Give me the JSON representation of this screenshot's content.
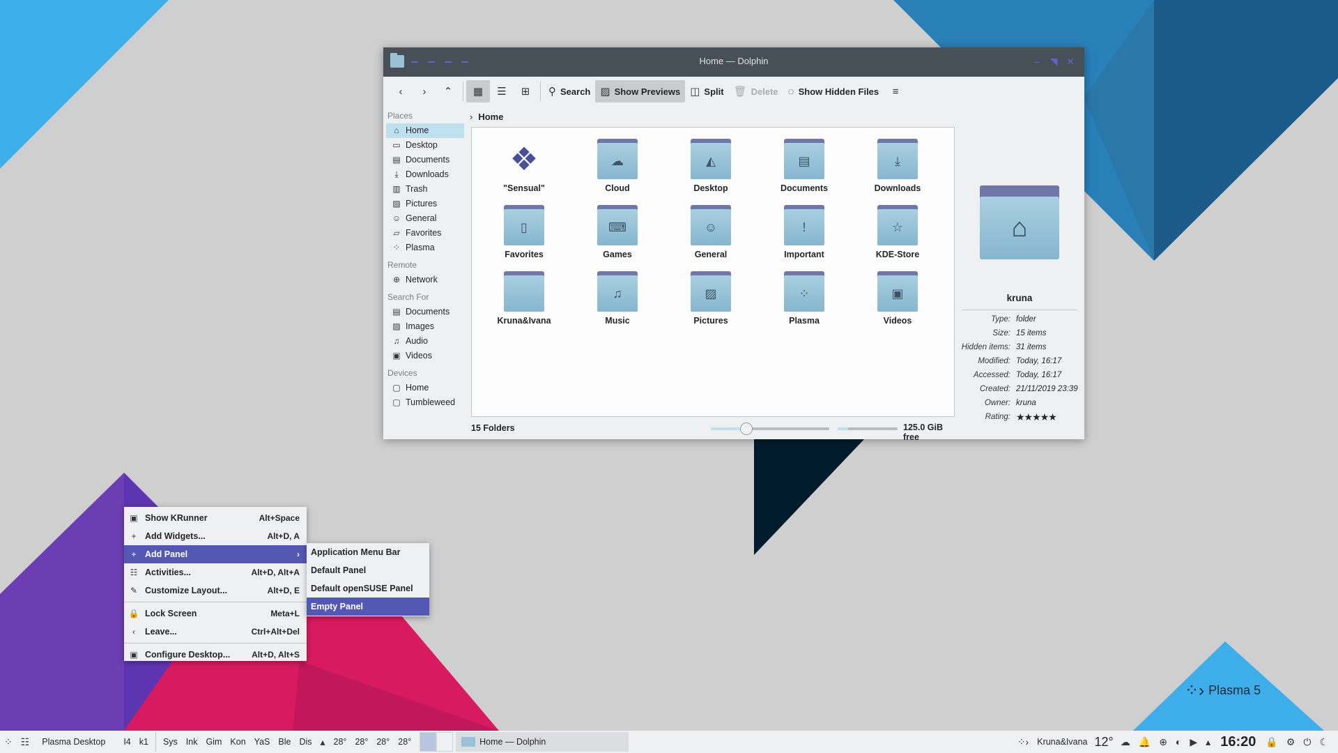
{
  "window": {
    "title": "Home — Dolphin"
  },
  "toolbar": {
    "back_icon": "back-icon",
    "forward_icon": "forward-icon",
    "up_icon": "up-icon",
    "search_label": "Search",
    "show_previews_label": "Show Previews",
    "split_label": "Split",
    "delete_label": "Delete",
    "show_hidden_label": "Show Hidden Files"
  },
  "places": {
    "places_header": "Places",
    "places_items": [
      {
        "label": "Home",
        "icon": "home-icon"
      },
      {
        "label": "Desktop",
        "icon": "desktop-icon"
      },
      {
        "label": "Documents",
        "icon": "documents-icon"
      },
      {
        "label": "Downloads",
        "icon": "downloads-icon"
      },
      {
        "label": "Trash",
        "icon": "trash-icon"
      },
      {
        "label": "Pictures",
        "icon": "pictures-icon"
      },
      {
        "label": "General",
        "icon": "general-icon"
      },
      {
        "label": "Favorites",
        "icon": "favorites-icon"
      },
      {
        "label": "Plasma",
        "icon": "plasma-icon"
      }
    ],
    "remote_header": "Remote",
    "remote_items": [
      {
        "label": "Network",
        "icon": "network-icon"
      }
    ],
    "search_header": "Search For",
    "search_items": [
      {
        "label": "Documents",
        "icon": "documents-icon"
      },
      {
        "label": "Images",
        "icon": "images-icon"
      },
      {
        "label": "Audio",
        "icon": "audio-icon"
      },
      {
        "label": "Videos",
        "icon": "videos-icon"
      }
    ],
    "devices_header": "Devices",
    "devices_items": [
      {
        "label": "Home",
        "icon": "drive-icon"
      },
      {
        "label": "Tumbleweed",
        "icon": "drive-icon"
      }
    ]
  },
  "breadcrumb": {
    "current": "Home"
  },
  "files": [
    {
      "name": "\"Sensual\"",
      "icon": "sensual-logo-icon"
    },
    {
      "name": "Cloud",
      "icon": "cloud-icon"
    },
    {
      "name": "Desktop",
      "icon": "desktop-folder-icon"
    },
    {
      "name": "Documents",
      "icon": "documents-folder-icon"
    },
    {
      "name": "Downloads",
      "icon": "downloads-folder-icon"
    },
    {
      "name": "Favorites",
      "icon": "favorites-folder-icon"
    },
    {
      "name": "Games",
      "icon": "games-folder-icon"
    },
    {
      "name": "General",
      "icon": "general-folder-icon"
    },
    {
      "name": "Important",
      "icon": "important-folder-icon"
    },
    {
      "name": "KDE-Store",
      "icon": "kde-store-folder-icon"
    },
    {
      "name": "Kruna&Ivana",
      "icon": "folder-icon"
    },
    {
      "name": "Music",
      "icon": "music-folder-icon"
    },
    {
      "name": "Pictures",
      "icon": "pictures-folder-icon"
    },
    {
      "name": "Plasma",
      "icon": "plasma-folder-icon"
    },
    {
      "name": "Videos",
      "icon": "videos-folder-icon"
    }
  ],
  "status": {
    "count": "15 Folders",
    "zoom_fraction": 0.3,
    "capacity_fraction": 0.18,
    "free": "125.0 GiB free"
  },
  "info_panel": {
    "name": "kruna",
    "props": [
      {
        "k": "Type:",
        "v": "folder"
      },
      {
        "k": "Size:",
        "v": "15 items"
      },
      {
        "k": "Hidden items:",
        "v": "31 items"
      },
      {
        "k": "Modified:",
        "v": "Today, 16:17"
      },
      {
        "k": "Accessed:",
        "v": "Today, 16:17"
      },
      {
        "k": "Created:",
        "v": "21/11/2019 23:39"
      },
      {
        "k": "Owner:",
        "v": "kruna"
      }
    ],
    "rating_label": "Rating:",
    "rating_stars": 5
  },
  "context_menu": {
    "items": [
      {
        "label": "Show KRunner",
        "shortcut": "Alt+Space",
        "icon": "krunner-icon"
      },
      {
        "label": "Add Widgets...",
        "shortcut": "Alt+D, A",
        "icon": "plus-icon"
      },
      {
        "label": "Add Panel",
        "shortcut": "",
        "icon": "plus-icon",
        "submenu": true
      },
      {
        "label": "Activities...",
        "shortcut": "Alt+D, Alt+A",
        "icon": "activities-icon"
      },
      {
        "label": "Customize Layout...",
        "shortcut": "Alt+D, E",
        "icon": "edit-icon"
      },
      {
        "sep": true
      },
      {
        "label": "Lock Screen",
        "shortcut": "Meta+L",
        "icon": "lock-icon"
      },
      {
        "label": "Leave...",
        "shortcut": "Ctrl+Alt+Del",
        "icon": "leave-icon"
      },
      {
        "sep": true
      },
      {
        "label": "Configure Desktop...",
        "shortcut": "Alt+D, Alt+S",
        "icon": "configure-icon"
      }
    ],
    "submenu": [
      "Application Menu Bar",
      "Default Panel",
      "Default openSUSE Panel",
      "Empty Panel"
    ]
  },
  "taskbar": {
    "activity": "Plasma Desktop",
    "quick": [
      "I4",
      "k1"
    ],
    "launchers": [
      "Sys",
      "Ink",
      "Gim",
      "Kon",
      "YaS",
      "Ble",
      "Dis"
    ],
    "temps": [
      "28°",
      "28°",
      "28°",
      "28°"
    ],
    "task_label": "Home — Dolphin",
    "user": "Kruna&Ivana",
    "weather": "12°",
    "clock": "16:20"
  },
  "desktop": {
    "logo_text": "Plasma 5"
  }
}
